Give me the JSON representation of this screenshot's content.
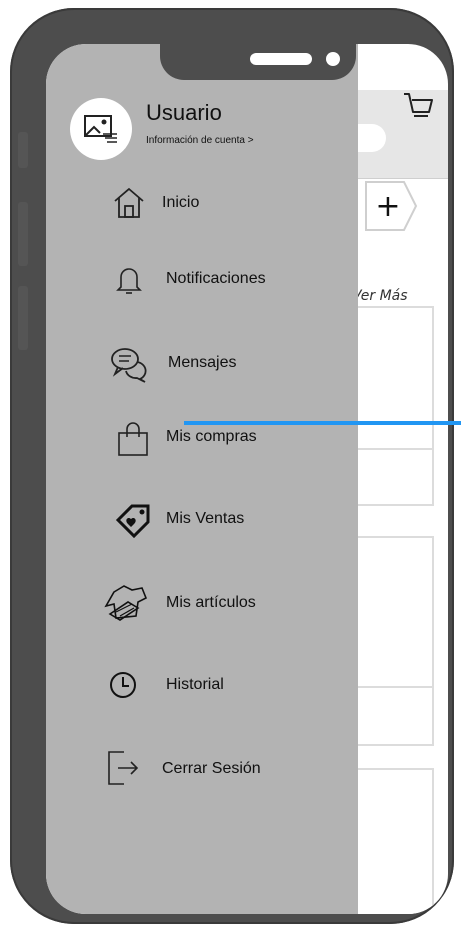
{
  "profile": {
    "name": "Usuario",
    "account_link": "Información de cuenta >"
  },
  "menu": [
    {
      "label": "Inicio",
      "icon": "home-icon"
    },
    {
      "label": "Notificaciones",
      "icon": "bell-icon"
    },
    {
      "label": "Mensajes",
      "icon": "chat-icon"
    },
    {
      "label": "Mis compras",
      "icon": "shopping-bag-icon"
    },
    {
      "label": "Mis Ventas",
      "icon": "sales-tag-icon"
    },
    {
      "label": "Mis artículos",
      "icon": "items-icon"
    },
    {
      "label": "Historial",
      "icon": "clock-icon"
    },
    {
      "label": "Cerrar Sesión",
      "icon": "logout-icon"
    }
  ],
  "background_app": {
    "ver_mas": "Ver Más",
    "plus": "+"
  },
  "colors": {
    "drawer": "#b3b3b3",
    "phone_frame": "#4d4d4d",
    "swipe_line": "#2196f3"
  }
}
